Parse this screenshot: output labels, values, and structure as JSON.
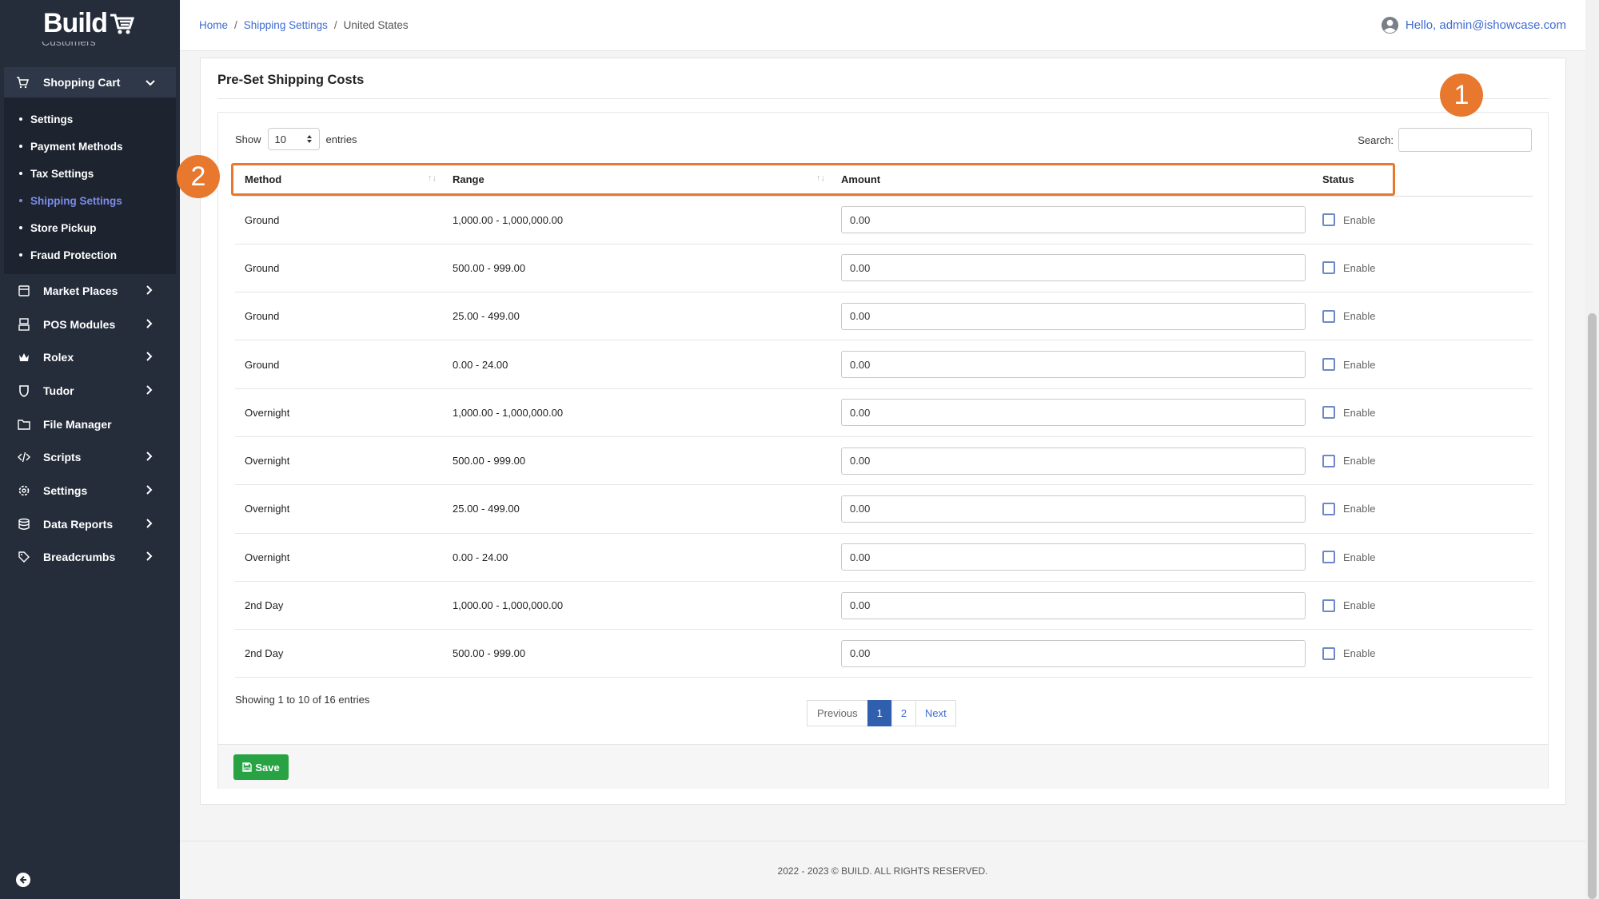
{
  "sidebar": {
    "logo": "Build",
    "cut_item": "Customers",
    "open_group": {
      "label": "Shopping Cart",
      "items": [
        {
          "label": "Settings",
          "active": false
        },
        {
          "label": "Payment Methods",
          "active": false
        },
        {
          "label": "Tax Settings",
          "active": false
        },
        {
          "label": "Shipping Settings",
          "active": true
        },
        {
          "label": "Store Pickup",
          "active": false
        },
        {
          "label": "Fraud Protection",
          "active": false
        }
      ]
    },
    "nav": [
      {
        "label": "Market Places",
        "icon": "store-icon",
        "has_chevron": true
      },
      {
        "label": "POS Modules",
        "icon": "register-icon",
        "has_chevron": true
      },
      {
        "label": "Rolex",
        "icon": "crown-icon",
        "has_chevron": true
      },
      {
        "label": "Tudor",
        "icon": "shield-icon",
        "has_chevron": true
      },
      {
        "label": "File Manager",
        "icon": "folder-icon",
        "has_chevron": false
      },
      {
        "label": "Scripts",
        "icon": "code-icon",
        "has_chevron": true
      },
      {
        "label": "Settings",
        "icon": "gear-icon",
        "has_chevron": true
      },
      {
        "label": "Data Reports",
        "icon": "database-icon",
        "has_chevron": true
      },
      {
        "label": "Breadcrumbs",
        "icon": "tag-icon",
        "has_chevron": true
      }
    ]
  },
  "topbar": {
    "breadcrumb": [
      "Home",
      "Shipping Settings",
      "United States"
    ],
    "greeting": "Hello, admin@ishowcase.com"
  },
  "card": {
    "title": "Pre-Set Shipping Costs",
    "show_label": "Show",
    "entries_label": "entries",
    "page_size": "10",
    "search_label": "Search:",
    "search_value": "",
    "markers": [
      "1",
      "2"
    ],
    "columns": [
      "Method",
      "Range",
      "Amount",
      "Status"
    ],
    "rows": [
      {
        "method": "Ground",
        "range": "1,000.00 - 1,000,000.00",
        "amount": "0.00",
        "status": "Enable"
      },
      {
        "method": "Ground",
        "range": "500.00 - 999.00",
        "amount": "0.00",
        "status": "Enable"
      },
      {
        "method": "Ground",
        "range": "25.00 - 499.00",
        "amount": "0.00",
        "status": "Enable"
      },
      {
        "method": "Ground",
        "range": "0.00 - 24.00",
        "amount": "0.00",
        "status": "Enable"
      },
      {
        "method": "Overnight",
        "range": "1,000.00 - 1,000,000.00",
        "amount": "0.00",
        "status": "Enable"
      },
      {
        "method": "Overnight",
        "range": "500.00 - 999.00",
        "amount": "0.00",
        "status": "Enable"
      },
      {
        "method": "Overnight",
        "range": "25.00 - 499.00",
        "amount": "0.00",
        "status": "Enable"
      },
      {
        "method": "Overnight",
        "range": "0.00 - 24.00",
        "amount": "0.00",
        "status": "Enable"
      },
      {
        "method": "2nd Day",
        "range": "1,000.00 - 1,000,000.00",
        "amount": "0.00",
        "status": "Enable"
      },
      {
        "method": "2nd Day",
        "range": "500.00 - 999.00",
        "amount": "0.00",
        "status": "Enable"
      }
    ],
    "info": "Showing 1 to 10 of 16 entries",
    "pager": {
      "prev": "Previous",
      "pages": [
        "1",
        "2"
      ],
      "current": "1",
      "next": "Next"
    },
    "save_label": "Save"
  },
  "footer": {
    "copyright": "2022 - 2023 © BUILD. ALL RIGHTS RESERVED."
  },
  "colors": {
    "sidebar_bg": "#252d3b",
    "accent": "#3f6bd1",
    "marker": "#e8782d",
    "save": "#27a344",
    "active_sub": "#7c8ce8"
  }
}
